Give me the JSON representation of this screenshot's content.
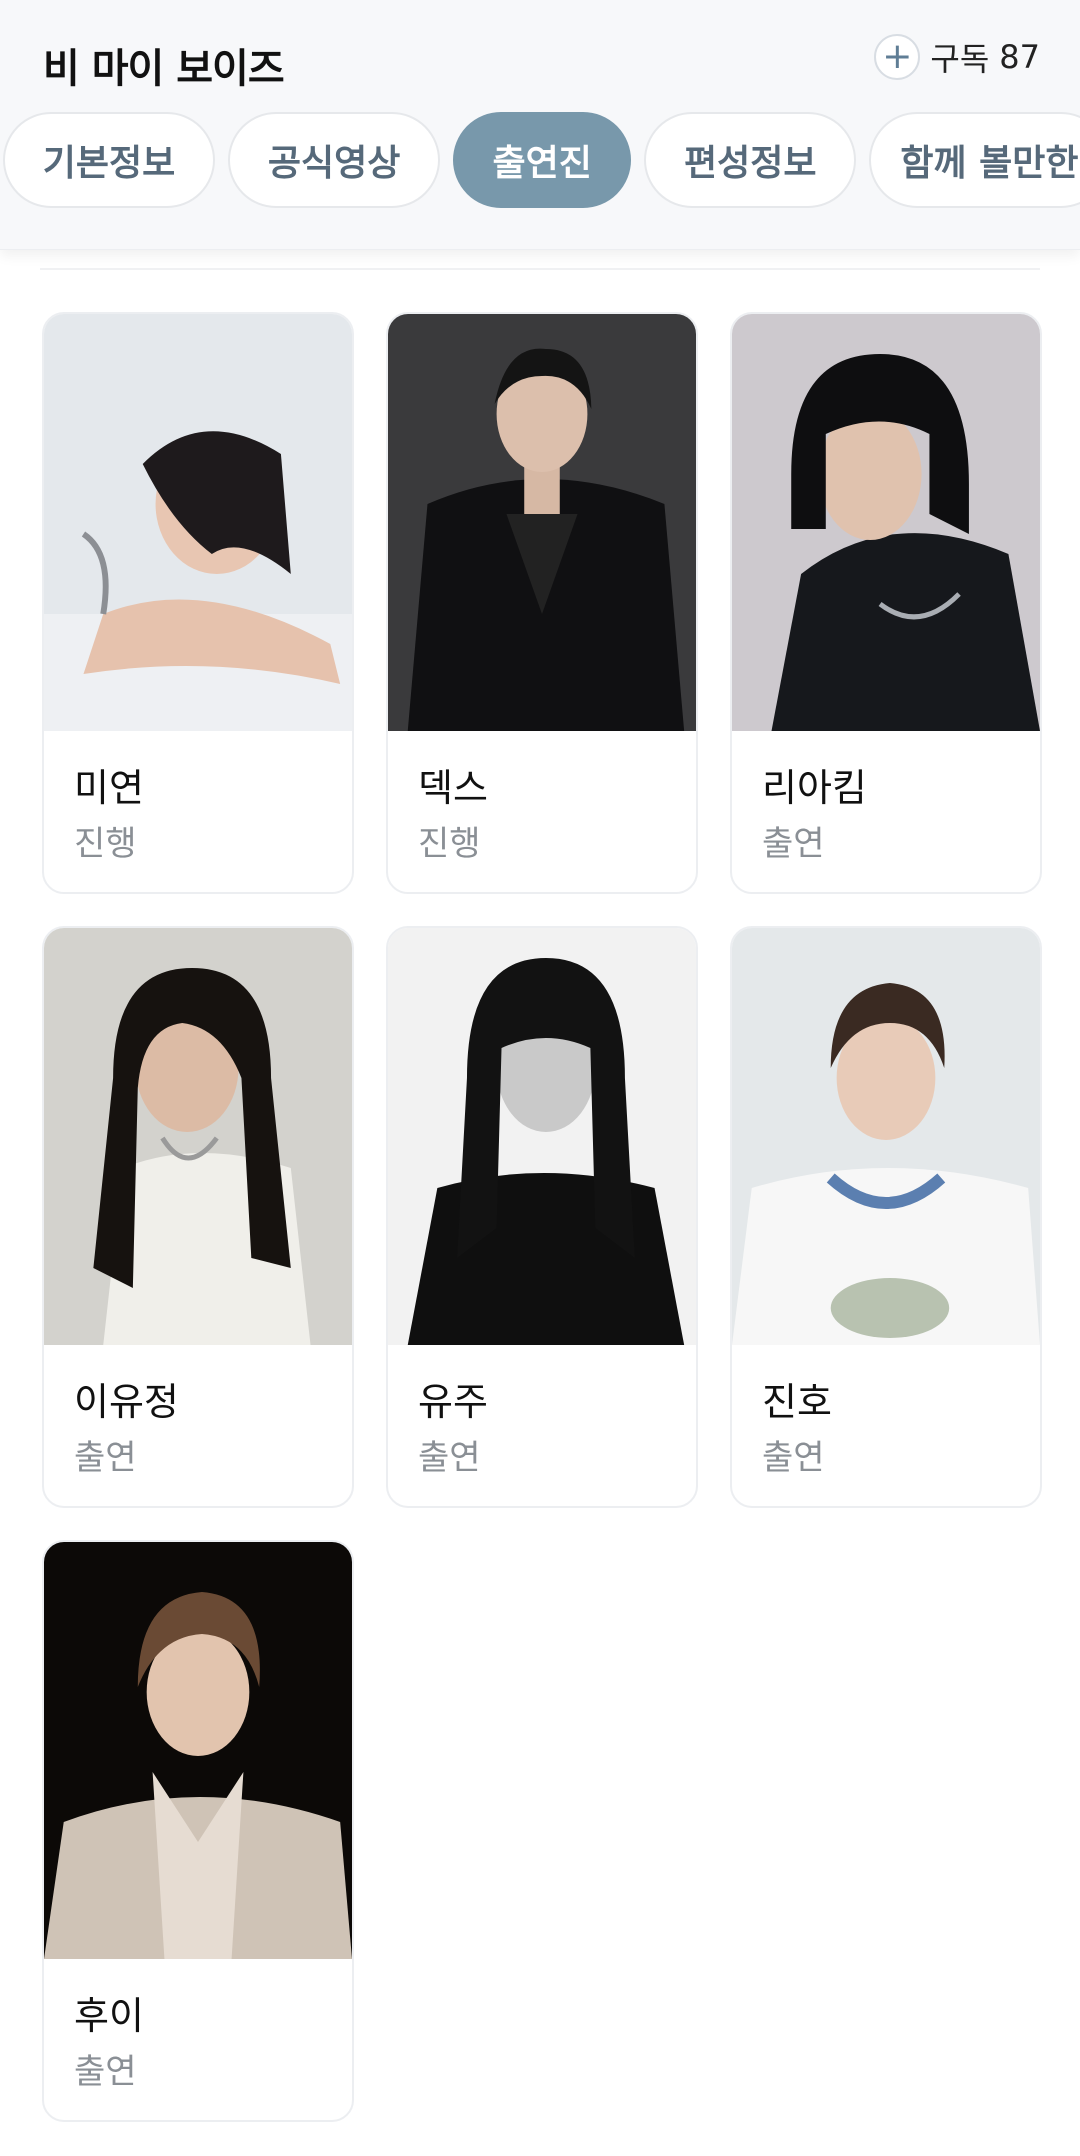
{
  "header": {
    "title": "비 마이 보이즈",
    "subscribe_label": "구독",
    "subscribe_count": "87"
  },
  "tabs": [
    {
      "label": "기본정보",
      "active": false
    },
    {
      "label": "공식영상",
      "active": false
    },
    {
      "label": "출연진",
      "active": true
    },
    {
      "label": "편성정보",
      "active": false
    },
    {
      "label": "함께 볼만한",
      "active": false
    }
  ],
  "cast": [
    {
      "name": "미연",
      "role": "진행"
    },
    {
      "name": "덱스",
      "role": "진행"
    },
    {
      "name": "리아킴",
      "role": "출연"
    },
    {
      "name": "이유정",
      "role": "출연"
    },
    {
      "name": "유주",
      "role": "출연"
    },
    {
      "name": "진호",
      "role": "출연"
    },
    {
      "name": "후이",
      "role": "출연"
    }
  ]
}
